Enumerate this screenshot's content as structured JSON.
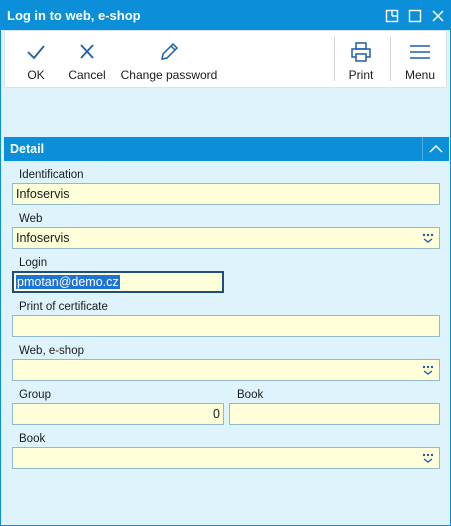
{
  "window": {
    "title": "Log in to web, e-shop",
    "controls": [
      "restore",
      "maximize",
      "close"
    ]
  },
  "toolbar": {
    "ok_label": "OK",
    "cancel_label": "Cancel",
    "change_password_label": "Change password",
    "print_label": "Print",
    "menu_label": "Menu"
  },
  "section": {
    "title": "Detail"
  },
  "form": {
    "identification": {
      "label": "Identification",
      "value": "Infoservis"
    },
    "web": {
      "label": "Web",
      "value": "Infoservis"
    },
    "login": {
      "label": "Login",
      "value": "pmotan@demo.cz"
    },
    "print_of_certificate": {
      "label": "Print of certificate",
      "value": ""
    },
    "web_eshop": {
      "label": "Web, e-shop",
      "value": ""
    },
    "group": {
      "label": "Group",
      "value": "0"
    },
    "book_right": {
      "label": "Book",
      "value": ""
    },
    "book": {
      "label": "Book",
      "value": ""
    }
  },
  "colors": {
    "accent": "#0a8fd8",
    "background": "#dff3fc",
    "field_background": "#fefed8",
    "selection": "#1e74d6"
  }
}
